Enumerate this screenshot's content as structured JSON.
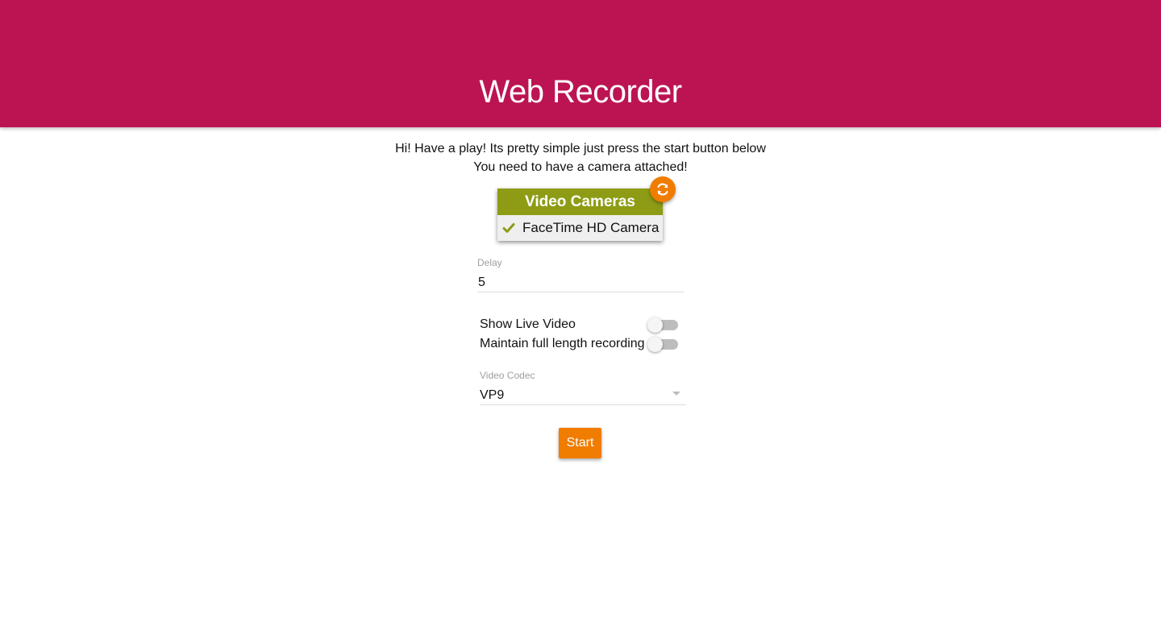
{
  "header": {
    "title": "Web Recorder",
    "background_color": "#bc1453"
  },
  "intro": {
    "line1": "Hi! Have a play! Its pretty simple just press the start button below",
    "line2": "You need to have a camera attached!"
  },
  "cameras": {
    "title": "Video Cameras",
    "header_color": "#8d9c14",
    "refresh_icon": "refresh-icon",
    "items": [
      {
        "label": "FaceTime HD Camera",
        "selected": true,
        "icon": "check-icon"
      }
    ]
  },
  "delay": {
    "label": "Delay",
    "value": "5"
  },
  "toggles": {
    "show_live_video": {
      "label": "Show Live Video",
      "on": false
    },
    "maintain_full_length": {
      "label": "Maintain full length recording",
      "on": false
    }
  },
  "codec": {
    "label": "Video Codec",
    "selected": "VP9"
  },
  "start_button": {
    "label": "Start",
    "color": "#f07c00"
  }
}
